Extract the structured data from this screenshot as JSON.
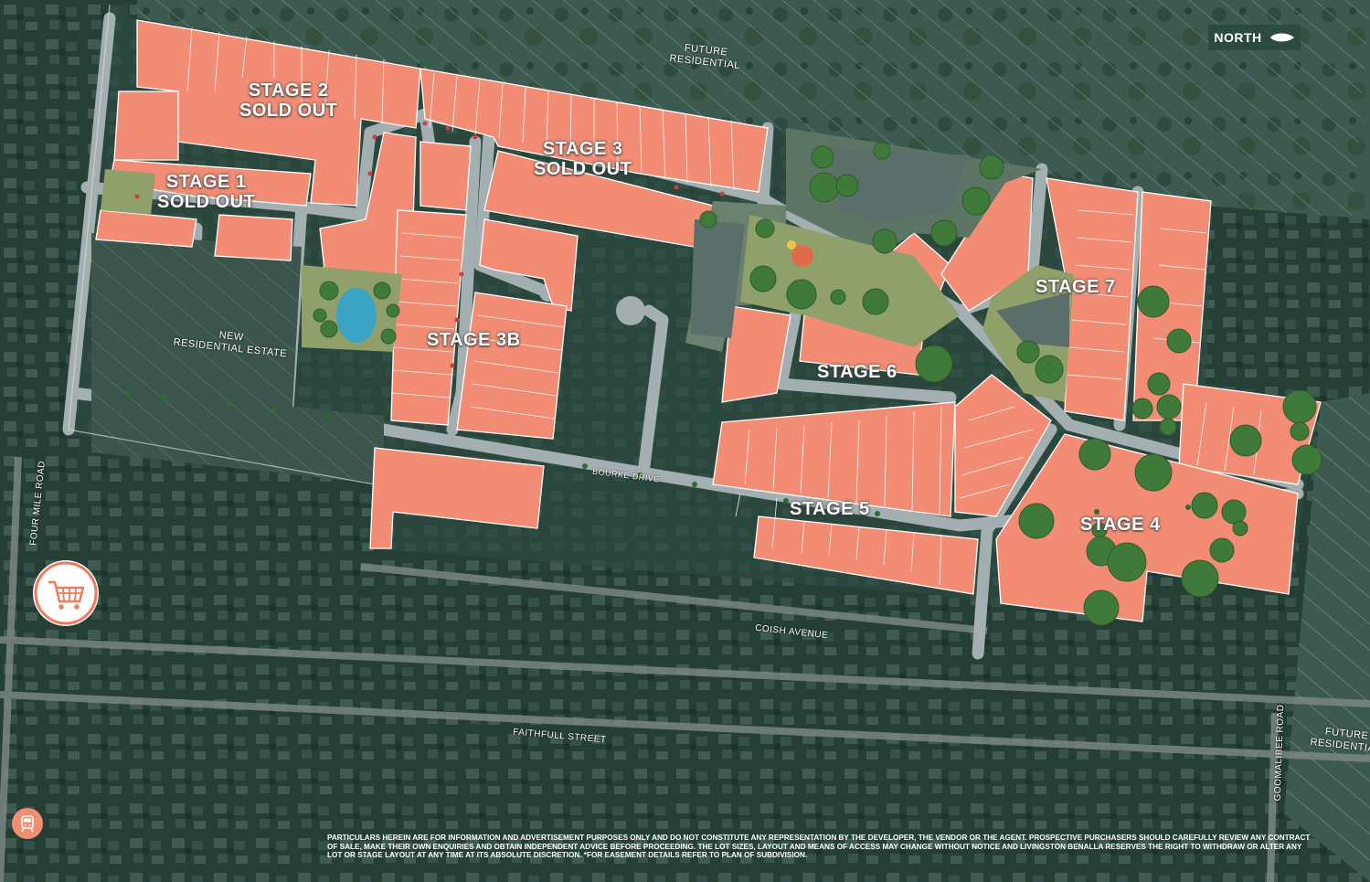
{
  "stages": [
    {
      "id": "stage-1",
      "lines": [
        "STAGE 1",
        "SOLD OUT"
      ]
    },
    {
      "id": "stage-2",
      "lines": [
        "STAGE 2",
        "SOLD OUT"
      ]
    },
    {
      "id": "stage-3",
      "lines": [
        "STAGE 3",
        "SOLD OUT"
      ]
    },
    {
      "id": "stage-3b",
      "lines": [
        "STAGE 3B"
      ]
    },
    {
      "id": "stage-4",
      "lines": [
        "STAGE 4"
      ]
    },
    {
      "id": "stage-5",
      "lines": [
        "STAGE 5"
      ]
    },
    {
      "id": "stage-6",
      "lines": [
        "STAGE 6"
      ]
    },
    {
      "id": "stage-7",
      "lines": [
        "STAGE 7"
      ]
    }
  ],
  "areas": {
    "future_residential_top": [
      "FUTURE",
      "RESIDENTIAL"
    ],
    "future_residential_right": [
      "FUTURE",
      "RESIDENTIAL"
    ],
    "new_residential_estate": [
      "NEW",
      "RESIDENTIAL ESTATE"
    ]
  },
  "streets": {
    "four_mile_road": "FOUR MILE ROAD",
    "bourke_drive": "BOURKE DRIVE",
    "coish_avenue": "COISH AVENUE",
    "faithfull_street": "FAITHFULL STREET",
    "goomalibee_road": "GOOMALIBEE ROAD"
  },
  "compass": {
    "label": "NORTH"
  },
  "icons": {
    "shopping": "shopping-cart-icon",
    "train": "train-icon"
  },
  "colors": {
    "lot": "#f28c75",
    "background": "#2b4a3e",
    "road": "#9aa5a8",
    "park": "#8fa06a",
    "accent": "#ef7a5c"
  },
  "disclaimer": "PARTICULARS HEREIN ARE FOR INFORMATION AND ADVERTISEMENT PURPOSES ONLY AND DO NOT CONSTITUTE ANY REPRESENTATION BY THE DEVELOPER, THE VENDOR OR THE AGENT. PROSPECTIVE PURCHASERS SHOULD CAREFULLY REVIEW ANY CONTRACT OF SALE, MAKE THEIR OWN ENQUIRIES AND OBTAIN INDEPENDENT ADVICE BEFORE PROCEEDING. THE LOT SIZES, LAYOUT AND MEANS OF ACCESS MAY CHANGE WITHOUT NOTICE AND LIVINGSTON BENALLA RESERVES THE RIGHT TO WITHDRAW OR ALTER ANY LOT OR STAGE LAYOUT AT ANY TIME AT ITS ABSOLUTE DISCRETION. *FOR EASEMENT DETAILS REFER TO PLAN OF SUBDIVISION."
}
